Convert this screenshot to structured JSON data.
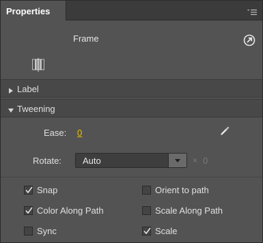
{
  "tab": {
    "title": "Properties"
  },
  "icons": {
    "panel_menu": "panel-menu-icon",
    "frame": "frame-icon",
    "help": "help-circle-arrow-icon",
    "pencil": "pencil-icon"
  },
  "header": {
    "title": "Frame"
  },
  "sections": {
    "label": {
      "title": "Label",
      "expanded": false
    },
    "tweening": {
      "title": "Tweening",
      "expanded": true
    }
  },
  "tweening": {
    "ease_label": "Ease:",
    "ease_value": "0",
    "rotate_label": "Rotate:",
    "rotate_value": "Auto",
    "rotate_times": "×",
    "rotate_count": "0"
  },
  "options": {
    "snap": {
      "label": "Snap",
      "checked": true
    },
    "orient_to_path": {
      "label": "Orient to path",
      "checked": false
    },
    "color_along_path": {
      "label": "Color Along Path",
      "checked": true
    },
    "scale_along_path": {
      "label": "Scale Along Path",
      "checked": false
    },
    "sync": {
      "label": "Sync",
      "checked": false
    },
    "scale": {
      "label": "Scale",
      "checked": true
    }
  },
  "colors": {
    "panel": "#535353",
    "accent_value": "#f0c000"
  }
}
